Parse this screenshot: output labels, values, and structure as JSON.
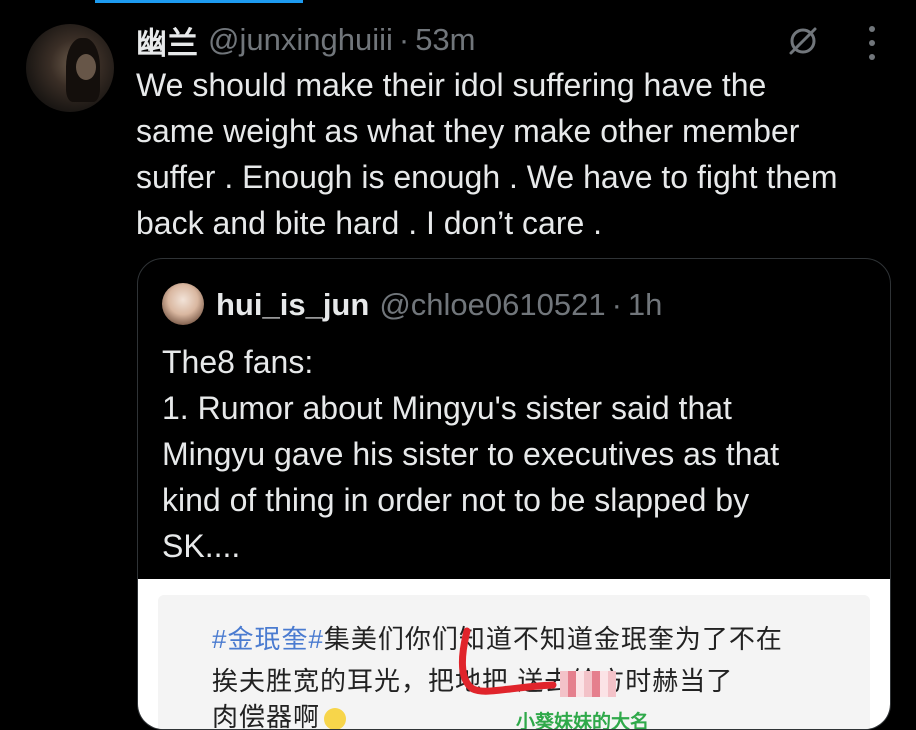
{
  "tweet": {
    "display_name": "幽兰",
    "handle": "@junxinghuiii",
    "separator": "·",
    "time": "53m",
    "text": "We should make their idol suffering have the\nsame weight as what they make other member\nsuffer . Enough is enough . We have to fight them\nback and bite hard . I don’t care ."
  },
  "quote": {
    "display_name": "hui_is_jun",
    "handle": "@chloe0610521",
    "separator": "·",
    "time": "1h",
    "text": "The8 fans:\n1. Rumor about Mingyu's sister said that\nMingyu gave his sister to executives as that\nkind of thing in order not to be slapped by\nSK....",
    "image": {
      "line1_hash": "#金珉奎#",
      "line1_rest": "集美们你们知道不知道金珉奎为了不在",
      "line2": "挨夫胜宽的耳光，把地把        送去给方时赫当了",
      "line3": "肉偿器啊",
      "caption": "小葵妹妹的大名"
    }
  },
  "icons": {
    "grok": "grok-icon",
    "more": "more-vertical-icon"
  },
  "colors": {
    "background": "#000000",
    "text": "#e7e9ea",
    "muted": "#71767b",
    "border": "#2f3336",
    "accent": "#1d9bf0"
  }
}
